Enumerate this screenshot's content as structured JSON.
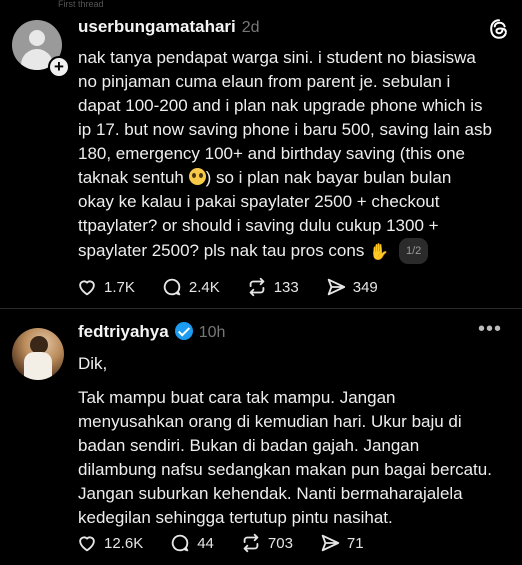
{
  "header_strip": {
    "text": "First thread"
  },
  "post1": {
    "username": "userbungamatahari",
    "time": "2d",
    "line1": "nak tanya pendapat warga sini. i student no biasiswa",
    "line2": "no pinjaman cuma elaun from parent je. sebulan i",
    "line3": "dapat 100-200 and i plan nak upgrade phone which is",
    "line4": "ip 17. but now saving phone i baru 500, saving lain asb",
    "line5": "180, emergency 100+ and birthday saving (this one",
    "line6a": "taknak sentuh ",
    "line6b": ") so i plan nak bayar bulan bulan",
    "line7": "okay ke kalau i pakai spaylater 2500 + checkout",
    "line8": "ttpaylater? or should i saving dulu cukup 1300 +",
    "line9": "spaylater 2500? pls nak tau pros cons ",
    "page_indicator": "1/2",
    "likes": "1.7K",
    "replies": "2.4K",
    "reposts": "133",
    "shares": "349"
  },
  "post2": {
    "username": "fedtriyahya",
    "time": "10h",
    "greeting": "Dik,",
    "line1": "Tak mampu buat cara tak mampu. Jangan",
    "line2": "menyusahkan orang di kemudian hari. Ukur baju di",
    "line3": "badan sendiri. Bukan di badan gajah. Jangan",
    "line4": "dilambung nafsu sedangkan makan pun bagai bercatu.",
    "line5": "Jangan suburkan kehendak. Nanti bermaharajalela",
    "line6": "kedegilan sehingga tertutup pintu nasihat.",
    "likes": "12.6K",
    "replies": "44",
    "reposts": "703",
    "shares": "71"
  },
  "icons": [
    "heart-icon",
    "reply-icon",
    "repost-icon",
    "share-icon",
    "threads-logo-icon",
    "more-icon",
    "verified-icon",
    "follow-plus-icon"
  ]
}
